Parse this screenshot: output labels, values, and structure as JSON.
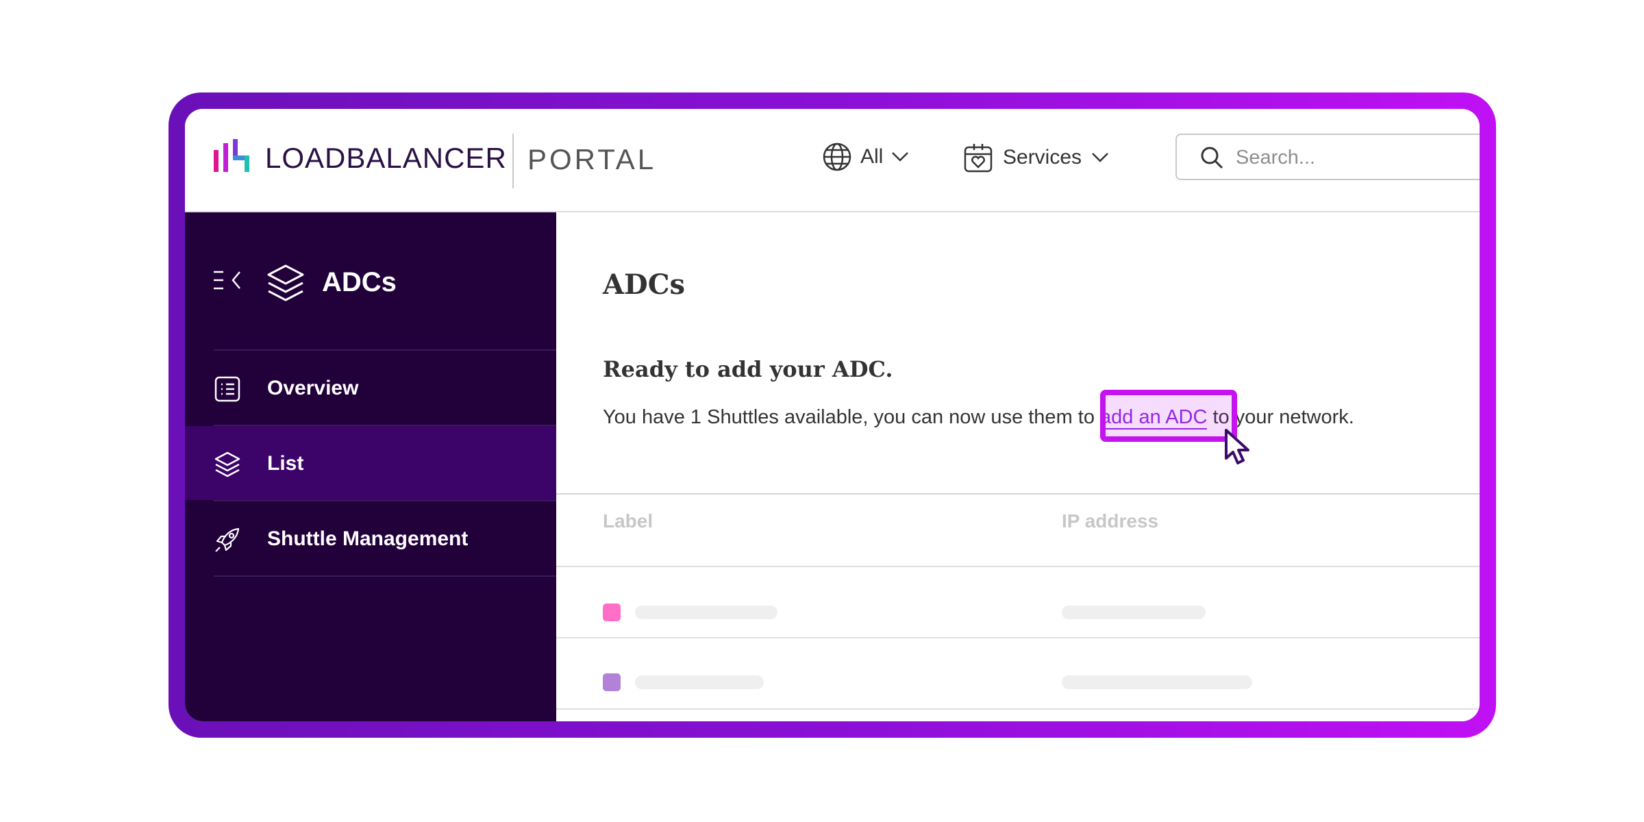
{
  "header": {
    "brand": "LOADBALANCER",
    "portal": "PORTAL",
    "region_label": "All",
    "services_label": "Services",
    "search_placeholder": "Search...",
    "search_value": ""
  },
  "sidebar": {
    "title": "ADCs",
    "items": [
      {
        "label": "Overview",
        "icon": "list-icon",
        "active": false
      },
      {
        "label": "List",
        "icon": "layers-icon",
        "active": true
      },
      {
        "label": "Shuttle Management",
        "icon": "rocket-icon",
        "active": false
      }
    ]
  },
  "main": {
    "title": "ADCs",
    "ready_heading": "Ready to add your ADC.",
    "ready_text_before": "You have 1 Shuttles available, you can now use them to ",
    "ready_link": "add an ADC",
    "ready_text_after": " to your network.",
    "table": {
      "columns": [
        "Label",
        "IP address"
      ],
      "rows": [
        {
          "status_color": "#ff6fc8"
        },
        {
          "status_color": "#b182d8"
        }
      ]
    }
  },
  "colors": {
    "accent": "#8a2be2",
    "highlight": "#c513ef",
    "sidebar_bg": "#22003a",
    "sidebar_active": "#3c0369"
  }
}
